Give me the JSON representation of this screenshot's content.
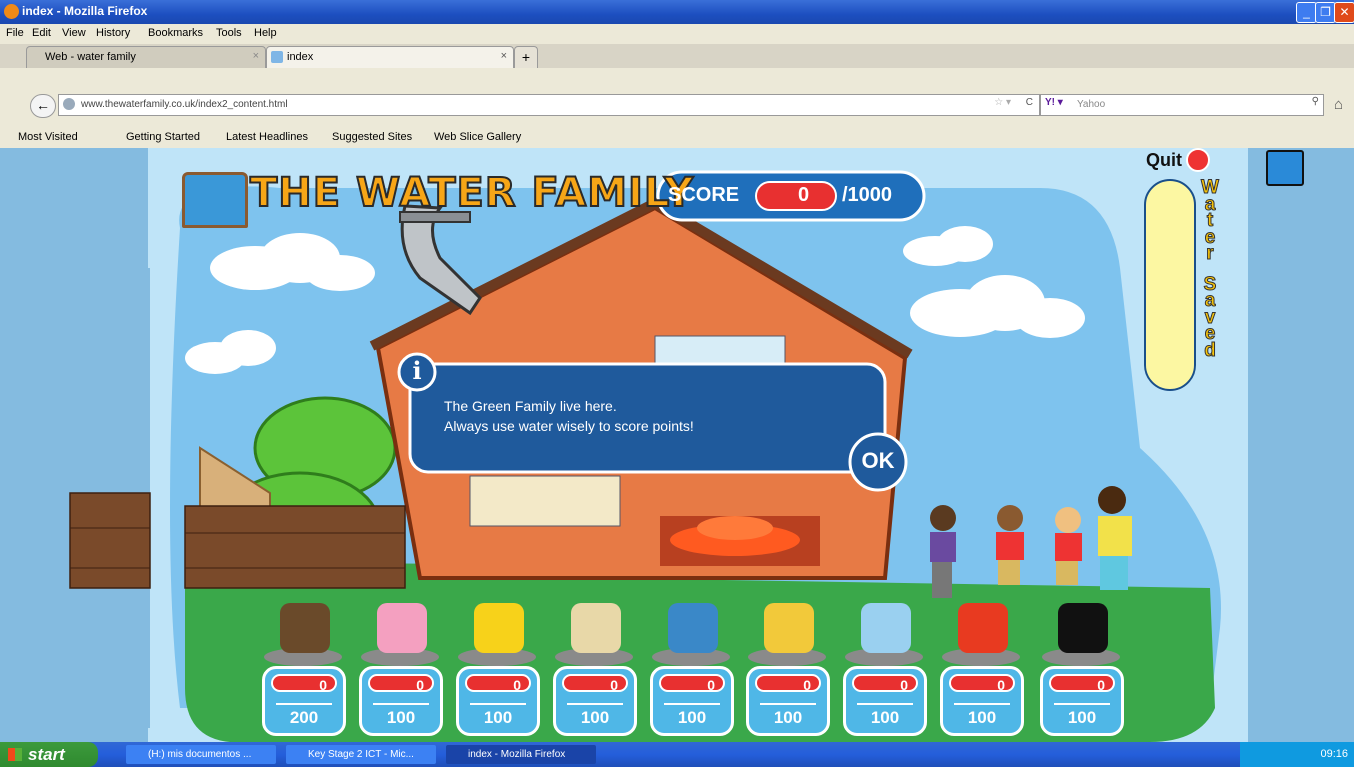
{
  "window": {
    "title": "index - Mozilla Firefox"
  },
  "menu": [
    "File",
    "Edit",
    "View",
    "History",
    "Bookmarks",
    "Tools",
    "Help"
  ],
  "tabs": [
    {
      "label": "Web - water family"
    },
    {
      "label": "index"
    }
  ],
  "address": {
    "url": "www.thewaterfamily.co.uk/index2_content.html"
  },
  "search": {
    "placeholder": "Yahoo"
  },
  "bookmarks": [
    "Most Visited",
    "Getting Started",
    "Latest Headlines",
    "Suggested Sites",
    "Web Slice Gallery"
  ],
  "game": {
    "logo": "THE WATER FAMILY",
    "score_label": "SCORE",
    "score_value": "0",
    "score_max": "/1000",
    "quit_label": "Quit",
    "meter_letters": [
      "W",
      "a",
      "t",
      "e",
      "r"
    ],
    "meter_letters2": [
      "S",
      "a",
      "v",
      "e",
      "d"
    ],
    "dialog_line1": "The Green Family live here.",
    "dialog_line2": "Always use water wisely to score points!",
    "ok_label": "OK",
    "info_label": "i",
    "slots": [
      {
        "icon": "hedgehogs",
        "count": "0",
        "value": "200"
      },
      {
        "icon": "dentures-glass",
        "count": "0",
        "value": "100"
      },
      {
        "icon": "rubber-duck",
        "count": "0",
        "value": "100"
      },
      {
        "icon": "toilet-roll",
        "count": "0",
        "value": "100"
      },
      {
        "icon": "bottle",
        "count": "0",
        "value": "100"
      },
      {
        "icon": "laundry-basket",
        "count": "0",
        "value": "100"
      },
      {
        "icon": "glasses-cups",
        "count": "0",
        "value": "100"
      },
      {
        "icon": "car",
        "count": "0",
        "value": "100"
      },
      {
        "icon": "mystery-box",
        "count": "0",
        "value": "100"
      }
    ]
  },
  "taskbar": {
    "start": "start",
    "items": [
      "(H:) mis documentos ...",
      "Key Stage 2 ICT - Mic...",
      "index - Mozilla Firefox"
    ],
    "clock": "09:16"
  },
  "colors": {
    "accent": "#1d4fc0",
    "score_red": "#e83030",
    "panel_blue": "#1f5a9c"
  }
}
